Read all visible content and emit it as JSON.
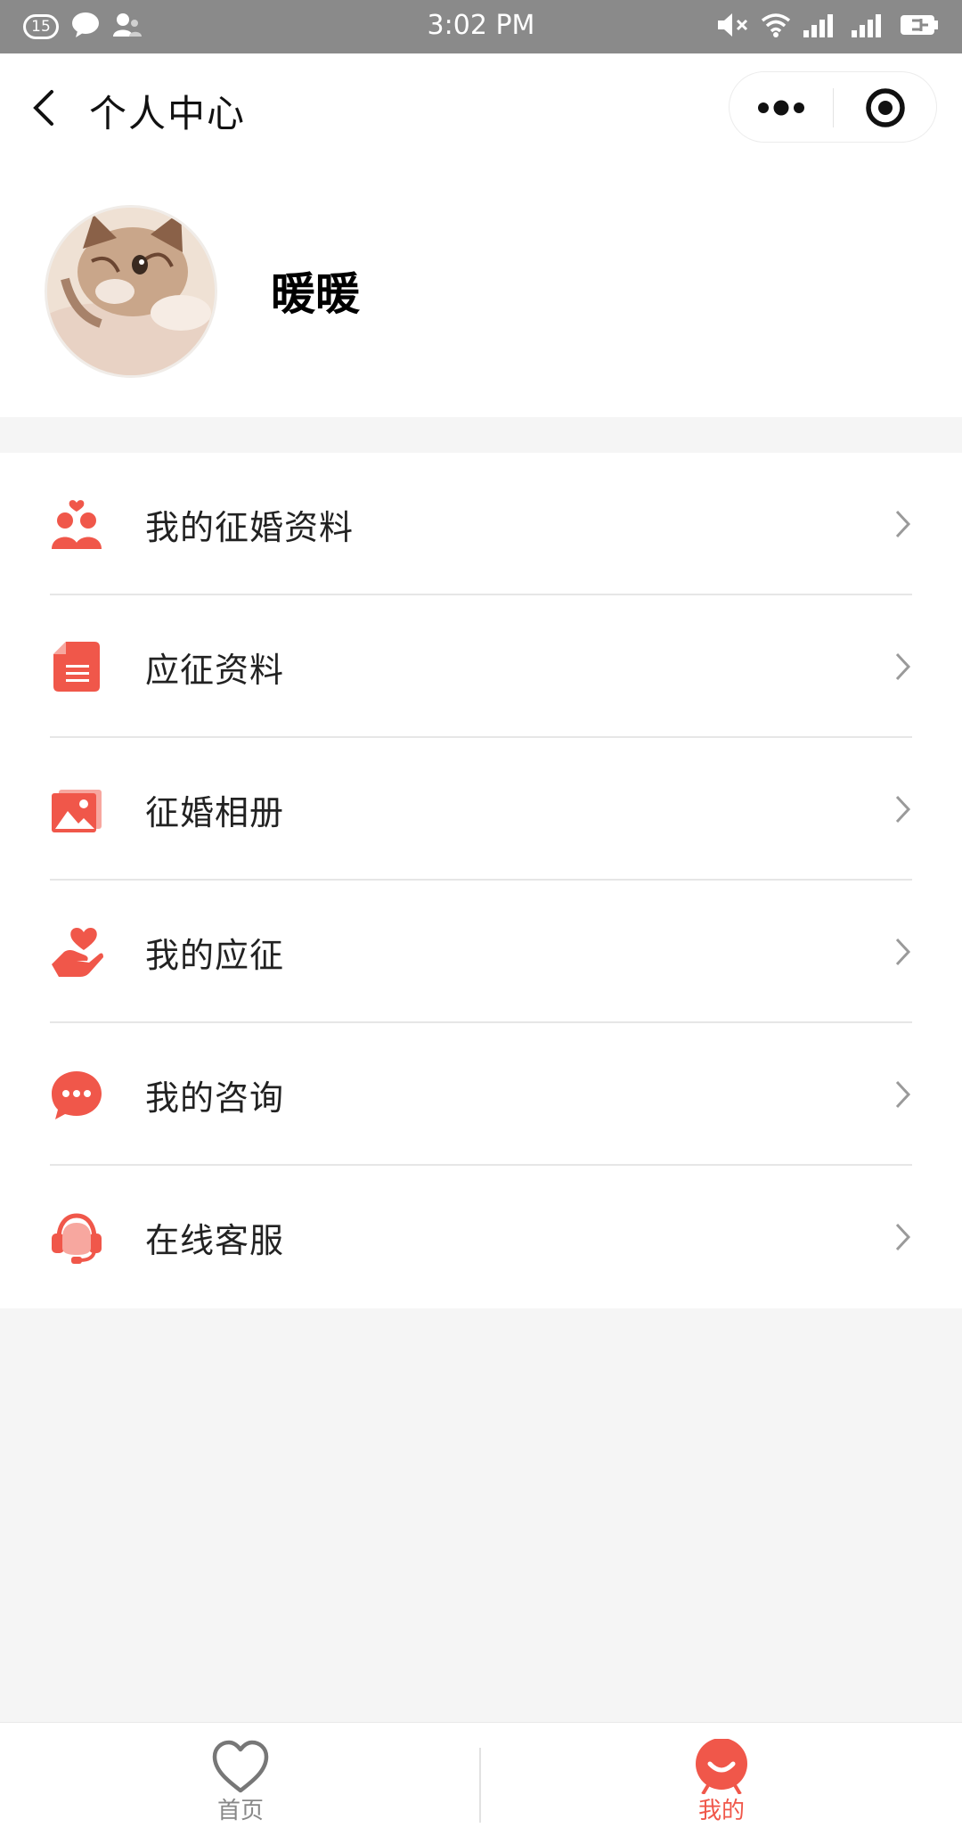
{
  "status_bar": {
    "notification_count": "15",
    "time": "3:02 PM"
  },
  "title_bar": {
    "title": "个人中心"
  },
  "profile": {
    "username": "暖暖"
  },
  "menu": {
    "items": [
      {
        "label": "我的征婚资料",
        "icon": "couple-icon"
      },
      {
        "label": "应征资料",
        "icon": "document-icon"
      },
      {
        "label": "征婚相册",
        "icon": "photo-album-icon"
      },
      {
        "label": "我的应征",
        "icon": "heart-in-hand-icon"
      },
      {
        "label": "我的咨询",
        "icon": "chat-bubble-icon"
      },
      {
        "label": "在线客服",
        "icon": "headset-icon"
      }
    ]
  },
  "tab_bar": {
    "home_label": "首页",
    "mine_label": "我的",
    "active_tab": "mine"
  },
  "colors": {
    "accent": "#f0574a",
    "status_bar_bg": "#8a8a8a",
    "page_bg": "#f5f5f5",
    "inactive_tab": "#888888"
  }
}
